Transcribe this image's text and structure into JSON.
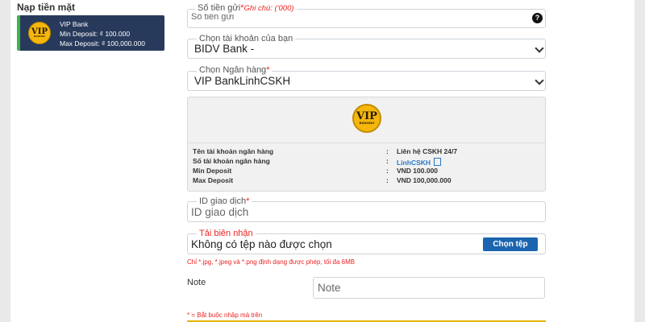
{
  "section_title": "Nạp tiền mặt",
  "method_card": {
    "logo_text": "VIP",
    "logo_subtext": "BANKING",
    "name": "VIP Bank",
    "min_deposit": "Min Deposit: ₫ 100.000",
    "max_deposit": "Max Deposit: ₫ 100,000.000"
  },
  "amount_field": {
    "legend": "Số tiền gửi",
    "required_mark": "*",
    "note": "Ghi chú: ('000)",
    "placeholder": "Số tiền gửi",
    "help_icon": "?"
  },
  "account_select": {
    "legend": "Chọn tài khoản của bạn",
    "value": "BIDV Bank -"
  },
  "bank_select": {
    "legend": "Chọn Ngân hàng",
    "required_mark": "*",
    "value": "VIP BankLinhCSKH"
  },
  "bank_info": {
    "logo_text": "VIP",
    "logo_subtext": "BANKING",
    "rows": [
      {
        "key": "Tên tài khoản ngân hàng",
        "sep": ":",
        "value": "Liên hệ CSKH 24/7"
      },
      {
        "key": "Số tài khoản ngân hàng",
        "sep": ":",
        "value": "LinhCSKH"
      },
      {
        "key": "Min Deposit",
        "sep": ":",
        "value": "VND 100.000"
      },
      {
        "key": "Max Deposit",
        "sep": ":",
        "value": "VND 100,000.000"
      }
    ]
  },
  "transaction_id": {
    "legend": "ID giao dịch",
    "required_mark": "*",
    "placeholder": "ID giao dịch"
  },
  "receipt_upload": {
    "legend": "Tải biên nhận",
    "status_text": "Không có tệp nào được chọn",
    "button_label": "Chọn tệp",
    "hint": "Chỉ *.jpg, *.jpeg và *.png định dạng được phép, tối đa 6MB"
  },
  "note_field": {
    "label": "Note",
    "placeholder": "Note"
  },
  "required_note": "* = Bắt buộc nhập mà trên",
  "colors": {
    "card_bg": "#283a5b",
    "card_accent": "#3bb54a",
    "button_bg": "#1b64b0",
    "required": "#e22222",
    "logo_gold": "#f5b70c"
  }
}
